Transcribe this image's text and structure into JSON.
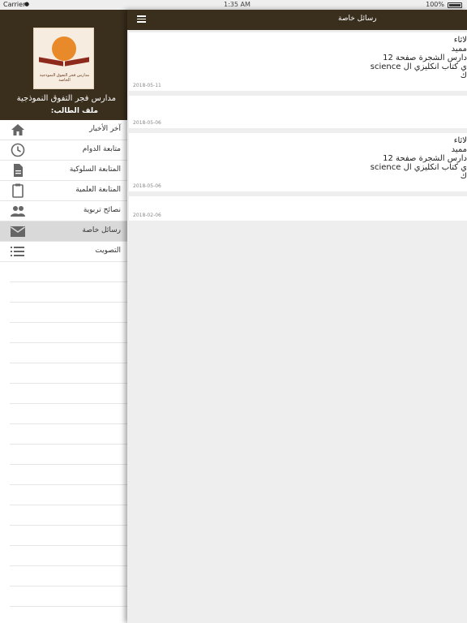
{
  "status": {
    "carrier": "Carrier",
    "time": "1:35 AM",
    "battery": "100%"
  },
  "sidebar": {
    "logo_text": "مدارس فجر التفوق النموذجية الخاصة",
    "school_name": "مدارس فجر التفوق النموذجية",
    "student_label": "ملف الطالب:",
    "items": [
      {
        "label": "آخر الأخبار",
        "icon": "home-icon"
      },
      {
        "label": "متابعة الدوام",
        "icon": "clock-icon"
      },
      {
        "label": "المتابعة السلوكية",
        "icon": "document-icon"
      },
      {
        "label": "المتابعة العلمية",
        "icon": "clipboard-icon"
      },
      {
        "label": "نصائح تربوية",
        "icon": "people-icon"
      },
      {
        "label": "رسائل خاصة",
        "icon": "mail-icon"
      },
      {
        "label": "التصويت",
        "icon": "list-icon"
      }
    ]
  },
  "header": {
    "title": "رسائل خاصة"
  },
  "messages": [
    {
      "lines": [
        "لاثاء",
        "مميد",
        "دارس الشجرة صفحة 12",
        "ي كتاب انكليزي ال  science",
        "ك"
      ],
      "date": "2018-05-11"
    },
    {
      "lines": [],
      "date": "2018-05-06"
    },
    {
      "lines": [
        "لاثاء",
        "مميد",
        "دارس الشجرة صفحة 12",
        "ي كتاب انكليزي ال  science",
        "ك"
      ],
      "date": "2018-05-06"
    },
    {
      "lines": [],
      "date": "2018-02-06"
    }
  ]
}
